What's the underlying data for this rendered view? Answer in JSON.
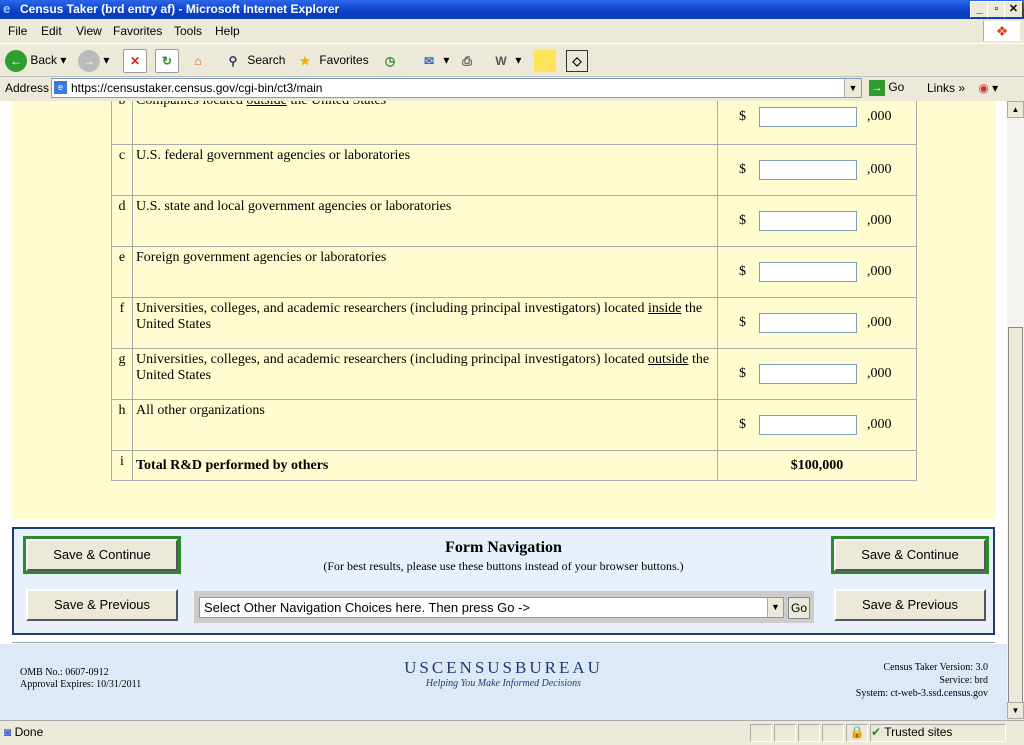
{
  "window": {
    "title": "Census Taker (brd entry af) - Microsoft Internet Explorer",
    "controls": {
      "minimize": "_",
      "maximize": "▫",
      "close": "✕"
    }
  },
  "menu": [
    "File",
    "Edit",
    "View",
    "Favorites",
    "Tools",
    "Help"
  ],
  "toolbar": {
    "back": "Back",
    "search": "Search",
    "favorites": "Favorites"
  },
  "address": {
    "label": "Address",
    "url": "https://censustaker.census.gov/cgi-bin/ct3/main",
    "go": "Go",
    "links": "Links"
  },
  "form": {
    "rows": [
      {
        "letter": "b",
        "parts": [
          "Companies located ",
          "outside",
          " the United States"
        ]
      },
      {
        "letter": "c",
        "parts": [
          "U.S. federal government agencies or laboratories",
          "",
          ""
        ]
      },
      {
        "letter": "d",
        "parts": [
          "U.S. state and local government agencies or laboratories",
          "",
          ""
        ]
      },
      {
        "letter": "e",
        "parts": [
          "Foreign government agencies or laboratories",
          "",
          ""
        ]
      },
      {
        "letter": "f",
        "parts": [
          "Universities, colleges, and academic researchers (including principal investigators) located ",
          "inside",
          " the United States"
        ]
      },
      {
        "letter": "g",
        "parts": [
          "Universities, colleges, and academic researchers (including principal investigators) located ",
          "outside",
          " the United States"
        ]
      },
      {
        "letter": "h",
        "parts": [
          "All other organizations",
          "",
          ""
        ]
      }
    ],
    "dollar_sign": "$",
    "thousands_suffix": ",000",
    "total": {
      "letter": "i",
      "label": "Total R&D performed by others",
      "value": "$100,000"
    }
  },
  "navigation": {
    "title": "Form Navigation",
    "subtitle": "(For best results, please use these buttons instead of your browser buttons.)",
    "save_continue": "Save & Continue",
    "save_previous": "Save & Previous",
    "select_text": "Select Other Navigation Choices here. Then press Go ->",
    "go": "Go"
  },
  "footer": {
    "omb": "OMB No.: 0607-0912",
    "expires": "Approval Expires: 10/31/2011",
    "logo": "USCENSUSBUREAU",
    "tagline": "Helping You Make Informed Decisions",
    "version": "Census Taker Version: 3.0",
    "service": "Service: brd",
    "system": "System: ct-web-3.ssd.census.gov"
  },
  "status": {
    "text": "Done",
    "zone": "Trusted sites"
  },
  "colors": {
    "form_background": "#fffdd0",
    "nav_border": "#1e3c70",
    "highlight_button_border": "#2b8a2b"
  }
}
